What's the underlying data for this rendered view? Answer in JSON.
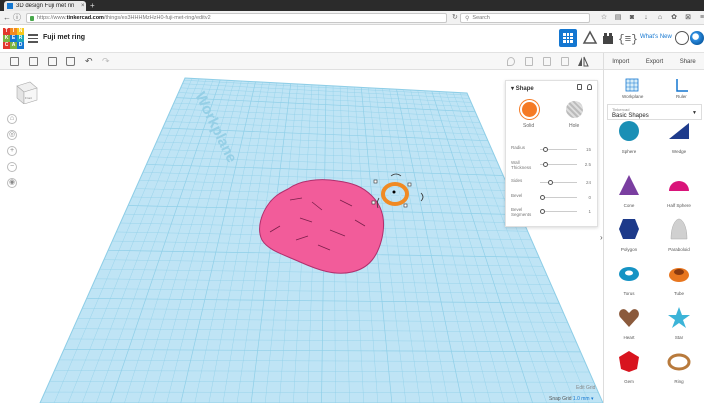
{
  "browser": {
    "tab_title": "3D design Fuji met rin",
    "tab_close": "×",
    "new_tab": "+",
    "url_prefix": "https://www.",
    "url_domain": "tinkercad.com",
    "url_path": "/things/es3HHHMzHzH0-fuji-met-ring/editv2",
    "search_placeholder": "Search"
  },
  "header": {
    "logo_letters": [
      "T",
      "I",
      "N",
      "K",
      "E",
      "R",
      "C",
      "A",
      "D"
    ],
    "logo_colors": [
      "#e2372c",
      "#f38a1e",
      "#f7c81c",
      "#7cb342",
      "#1477d1",
      "#1aa6b7",
      "#e2372c",
      "#7cb342",
      "#1477d1"
    ],
    "design_name": "Fuji met ring",
    "whats_new": "What's New"
  },
  "toolbar": {
    "import": "Import",
    "export": "Export",
    "share": "Share"
  },
  "workplane": {
    "label": "Workplane",
    "view_cube_face": "Front",
    "edit_grid": "Edit Grid",
    "snap_grid_label": "Snap Grid",
    "snap_grid_value": "1.0 mm ▾",
    "accent": "#1477d1",
    "plane_fill": "#bfe4f5",
    "shape_color": "#f25c9a",
    "ring_color": "#f08a24"
  },
  "inspector": {
    "title": "Shape",
    "solid_label": "Solid",
    "hole_label": "Hole",
    "solid_color": "#f57a24",
    "props": [
      {
        "label": "Radius",
        "value": "15",
        "pos": 0.08
      },
      {
        "label": "Wall Thickness",
        "value": "2.5",
        "pos": 0.08
      },
      {
        "label": "Sides",
        "value": "24",
        "pos": 0.25
      },
      {
        "label": "Bevel",
        "value": "0",
        "pos": 0.0
      },
      {
        "label": "Bevel Segments",
        "value": "1",
        "pos": 0.0
      }
    ]
  },
  "library": {
    "workplane_label": "Workplane",
    "ruler_label": "Ruler",
    "category_small": "Tinkercad",
    "category": "Basic Shapes",
    "shapes": [
      {
        "name": "Sphere",
        "color": "#1a8fb5"
      },
      {
        "name": "Wedge",
        "color": "#1f3c8c"
      },
      {
        "name": "Cone",
        "color": "#7a3ea0"
      },
      {
        "name": "Half Sphere",
        "color": "#d9147a"
      },
      {
        "name": "Polygon",
        "color": "#1d3a8a"
      },
      {
        "name": "Paraboloid",
        "color": "#d0d0d0"
      },
      {
        "name": "Torus",
        "color": "#1593c4"
      },
      {
        "name": "Tube",
        "color": "#e8761f"
      },
      {
        "name": "Heart",
        "color": "#8b5a3c"
      },
      {
        "name": "Star",
        "color": "#3cb4d8"
      },
      {
        "name": "Gem",
        "color": "#d8141e"
      },
      {
        "name": "Ring",
        "color": "#b87a3c"
      }
    ]
  }
}
